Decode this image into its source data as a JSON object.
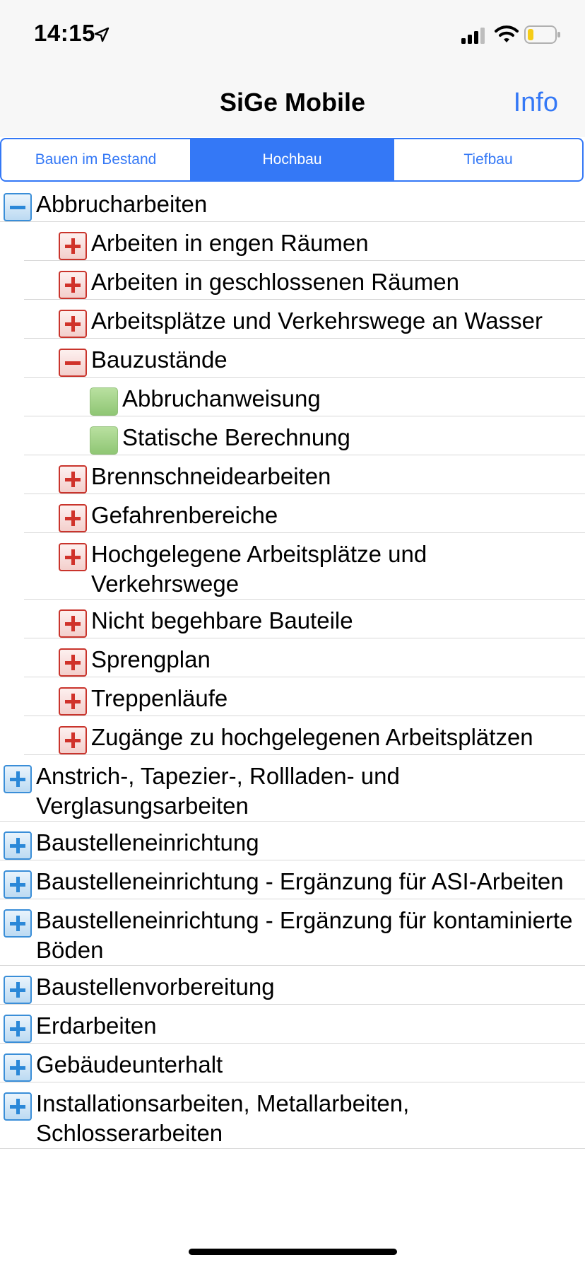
{
  "status_bar": {
    "time": "14:15"
  },
  "nav": {
    "title": "SiGe Mobile",
    "info_label": "Info"
  },
  "segments": [
    {
      "label": "Bauen im Bestand",
      "selected": false
    },
    {
      "label": "Hochbau",
      "selected": true
    },
    {
      "label": "Tiefbau",
      "selected": false
    }
  ],
  "tree": [
    {
      "label": "Abbrucharbeiten",
      "level": 0,
      "icon": "collapse-blue"
    },
    {
      "label": "Arbeiten in engen Räumen",
      "level": 1,
      "icon": "expand-red"
    },
    {
      "label": "Arbeiten in geschlossenen Räumen",
      "level": 1,
      "icon": "expand-red"
    },
    {
      "label": "Arbeitsplätze und Verkehrswege an Wasser",
      "level": 1,
      "icon": "expand-red"
    },
    {
      "label": "Bauzustände",
      "level": 1,
      "icon": "collapse-red"
    },
    {
      "label": "Abbruchanweisung",
      "level": 2,
      "icon": "leaf-green"
    },
    {
      "label": "Statische Berechnung",
      "level": 2,
      "icon": "leaf-green"
    },
    {
      "label": "Brennschneidearbeiten",
      "level": 1,
      "icon": "expand-red"
    },
    {
      "label": "Gefahrenbereiche",
      "level": 1,
      "icon": "expand-red"
    },
    {
      "label": "Hochgelegene Arbeitsplätze und Verkehrswege",
      "level": 1,
      "icon": "expand-red"
    },
    {
      "label": "Nicht begehbare Bauteile",
      "level": 1,
      "icon": "expand-red"
    },
    {
      "label": "Sprengplan",
      "level": 1,
      "icon": "expand-red"
    },
    {
      "label": "Treppenläufe",
      "level": 1,
      "icon": "expand-red"
    },
    {
      "label": "Zugänge zu hochgelegenen Arbeitsplätzen",
      "level": 1,
      "icon": "expand-red"
    },
    {
      "label": "Anstrich-, Tapezier-, Rollladen- und Verglasungsarbeiten",
      "level": 0,
      "icon": "expand-blue"
    },
    {
      "label": "Baustelleneinrichtung",
      "level": 0,
      "icon": "expand-blue"
    },
    {
      "label": "Baustelleneinrichtung - Ergänzung für ASI-Arbeiten",
      "level": 0,
      "icon": "expand-blue"
    },
    {
      "label": "Baustelleneinrichtung - Ergänzung für kontaminierte Böden",
      "level": 0,
      "icon": "expand-blue"
    },
    {
      "label": "Baustellenvorbereitung",
      "level": 0,
      "icon": "expand-blue"
    },
    {
      "label": "Erdarbeiten",
      "level": 0,
      "icon": "expand-blue"
    },
    {
      "label": "Gebäudeunterhalt",
      "level": 0,
      "icon": "expand-blue"
    },
    {
      "label": "Installationsarbeiten, Metallarbeiten, Schlosserarbeiten",
      "level": 0,
      "icon": "expand-blue"
    }
  ]
}
